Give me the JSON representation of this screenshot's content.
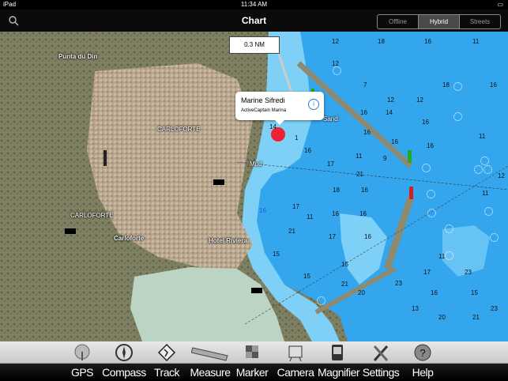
{
  "status_bar": {
    "device": "iPad",
    "time": "11:34 AM"
  },
  "nav": {
    "title": "Chart",
    "segments": [
      "Offline",
      "Hybrid",
      "Streets"
    ],
    "active_segment": "Hybrid"
  },
  "colors": {
    "land": "#8a8a6e",
    "water_deep": "#33a6ee",
    "water_shallow": "#7ed0f6",
    "lagoon": "#bcd4c4",
    "breakwater": "#8e8a72"
  },
  "scale": {
    "label": "0.3 NM"
  },
  "popup": {
    "title": "Marine Sifredi",
    "subtitle": "ActiveCaptain Marina",
    "info_icon": "info-icon"
  },
  "place_labels": [
    "Punta du Din",
    "CARLOFORTE",
    "CARLOFORTE",
    "Carloforte",
    "Hotel Riviera",
    "Mud",
    "Sand",
    "16"
  ],
  "depths": [
    "12",
    "18",
    "16",
    "11",
    "7",
    "12",
    "12",
    "18",
    "16",
    "12",
    "16",
    "14",
    "16",
    "11",
    "16",
    "14",
    "16",
    "1",
    "16",
    "11",
    "9",
    "16",
    "17",
    "21",
    "12",
    "18",
    "16",
    "11",
    "17",
    "11",
    "16",
    "16",
    "17",
    "16",
    "21",
    "15",
    "15",
    "15",
    "20",
    "21",
    "23",
    "11",
    "17",
    "23",
    "16",
    "15",
    "13",
    "20",
    "21",
    "23"
  ],
  "toolbar": {
    "items": [
      {
        "label": "GPS",
        "icon": "satellite-dish-icon"
      },
      {
        "label": "Compass",
        "icon": "compass-icon"
      },
      {
        "label": "Track",
        "icon": "track-icon"
      },
      {
        "label": "Measure",
        "icon": "ruler-icon"
      },
      {
        "label": "Marker",
        "icon": "marker-icon"
      },
      {
        "label": "Camera",
        "icon": "camera-icon"
      },
      {
        "label": "Magnifier",
        "icon": "magnifier-icon"
      },
      {
        "label": "Settings",
        "icon": "settings-icon"
      },
      {
        "label": "Help",
        "icon": "help-icon"
      }
    ]
  }
}
